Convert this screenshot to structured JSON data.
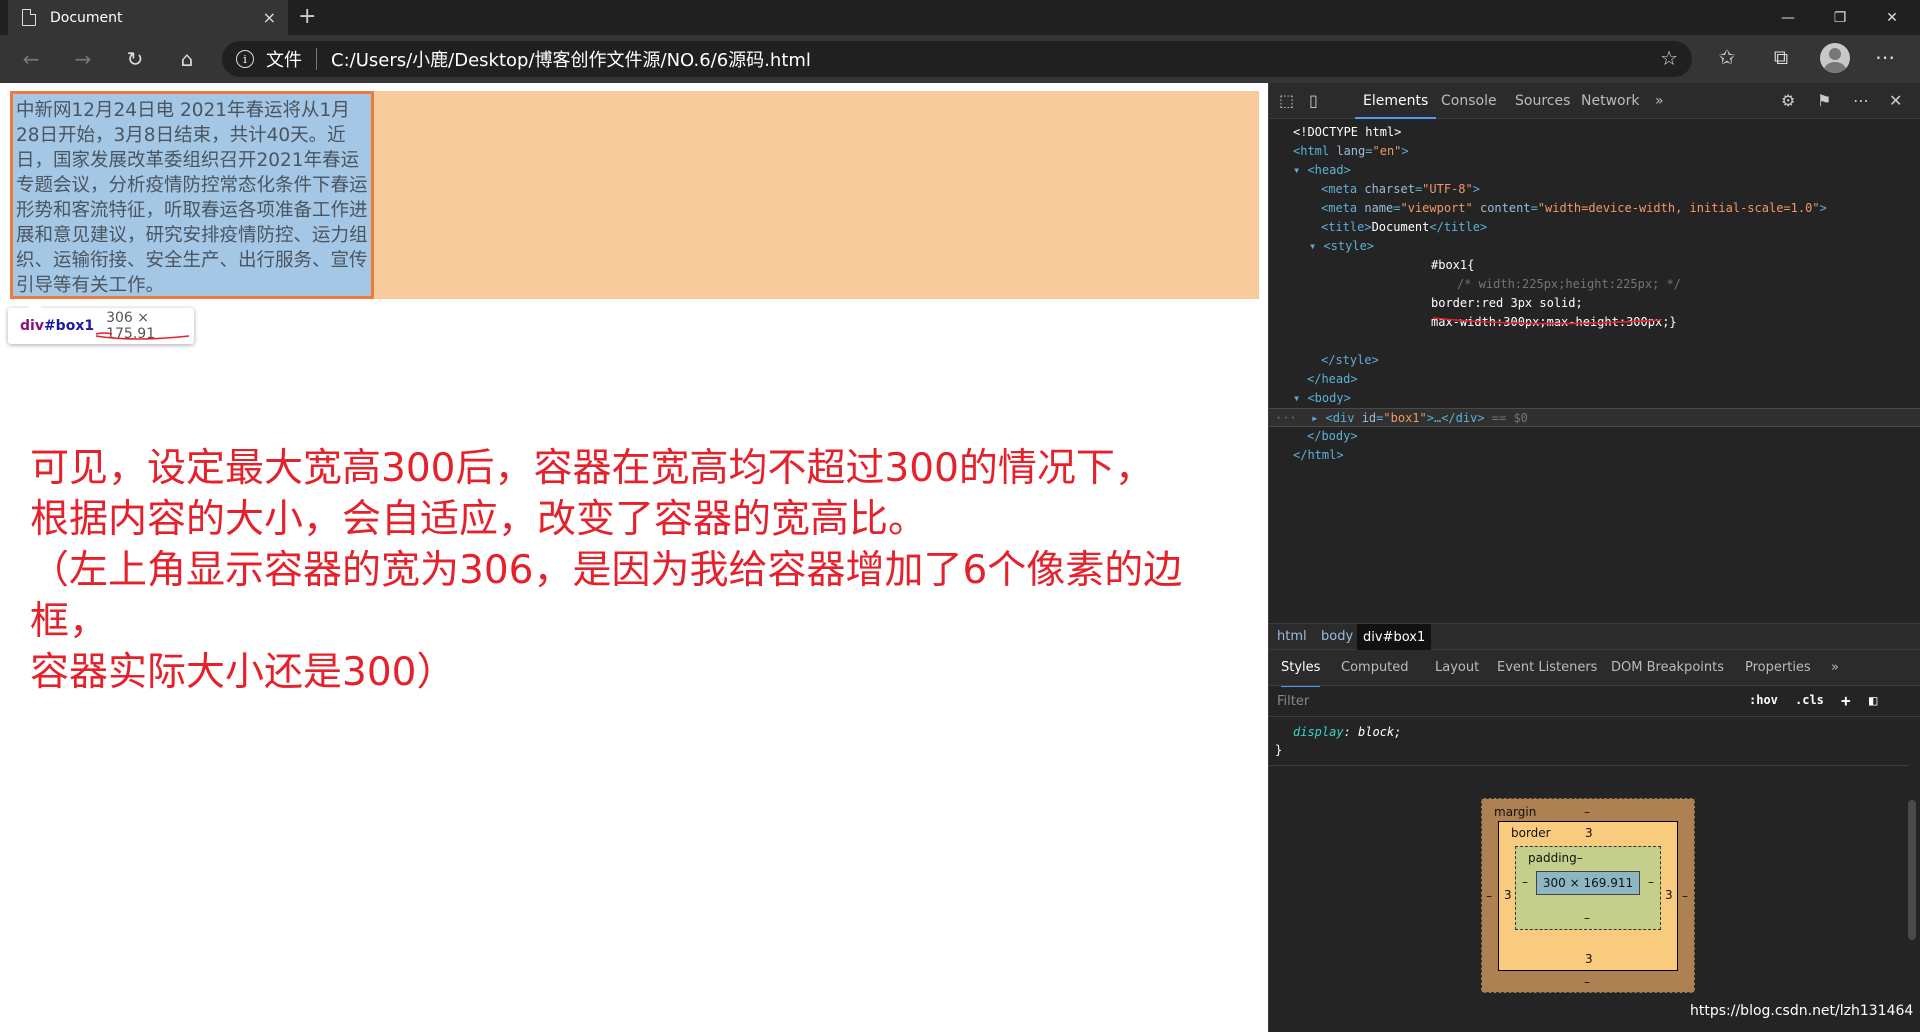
{
  "browser": {
    "tab_title": "Document",
    "tab_close": "×",
    "new_tab": "+",
    "minimize": "—",
    "restore": "❐",
    "close": "✕",
    "address_label": "文件",
    "address_url": "C:/Users/小鹿/Desktop/博客创作文件源/NO.6/6源码.html"
  },
  "page": {
    "box_text": "中新网12月24日电 2021年春运将从1月28日开始，3月8日结束，共计40天。近日，国家发展改革委组织召开2021年春运专题会议，分析疫情防控常态化条件下春运形势和客流特征，听取春运各项准备工作进展和意见建议，研究安排疫情防控、运力组织、运输衔接、安全生产、出行服务、宣传引导等有关工作。",
    "tooltip_tag": "div",
    "tooltip_id": "#box1",
    "tooltip_size": "306 × 175.91",
    "annotation_lines": [
      "可见，设定最大宽高300后，容器在宽高均不超过300的情况下，",
      "根据内容的大小，会自适应，改变了容器的宽高比。",
      "（左上角显示容器的宽为306，是因为我给容器增加了6个像素的边框，",
      "容器实际大小还是300）"
    ]
  },
  "devtools": {
    "tabs": [
      "Elements",
      "Console",
      "Sources",
      "Network"
    ],
    "more": "»",
    "dom": {
      "doctype": "<!DOCTYPE html>",
      "html_open_tag": "<html ",
      "html_lang_attr": "lang",
      "html_lang_val": "\"en\"",
      "head_open": "<head>",
      "meta1_tag": "<meta ",
      "meta1_attr": "charset",
      "meta1_val": "\"UTF-8\"",
      "meta2_tag": "<meta ",
      "meta2_attr1": "name",
      "meta2_val1": "\"viewport\"",
      "meta2_attr2": "content",
      "meta2_val2": "\"width=device-width, initial-scale=1.0\"",
      "title_open": "<title>",
      "title_text": "Document",
      "title_close": "</title>",
      "style_open": "<style>",
      "css_selector": "#box1{",
      "css_comment": "/* width:225px;height:225px; */",
      "css_border": "border:red 3px solid;",
      "css_max": "max-width:300px;max-height:300px;}",
      "style_close": "</style>",
      "head_close": "</head>",
      "body_open": "<body>",
      "div_open": "<div ",
      "div_attr": "id",
      "div_val": "\"box1\"",
      "div_rest": ">…</div>",
      "div_eq": " == $0",
      "body_close": "</body>",
      "html_close": "</html>"
    },
    "breadcrumbs": [
      "html",
      "body",
      "div#box1"
    ],
    "style_tabs": [
      "Styles",
      "Computed",
      "Layout",
      "Event Listeners",
      "DOM Breakpoints",
      "Properties"
    ],
    "filter_placeholder": "Filter",
    "filter_hov": ":hov",
    "filter_cls": ".cls",
    "rule_prop": "display",
    "rule_val": "block;",
    "rule_close": "}",
    "box_model": {
      "margin_label": "margin",
      "margin_top": "–",
      "margin_bottom": "–",
      "margin_left": "–",
      "margin_right": "–",
      "border_label": "border",
      "border_top": "3",
      "border_bottom": "3",
      "border_left": "3",
      "border_right": "3",
      "padding_label": "padding–",
      "padding_bottom": "–",
      "padding_left": "–",
      "padding_right": "–",
      "content_size": "300 × 169.911"
    }
  },
  "watermark": "https://blog.csdn.net/lzh131464"
}
